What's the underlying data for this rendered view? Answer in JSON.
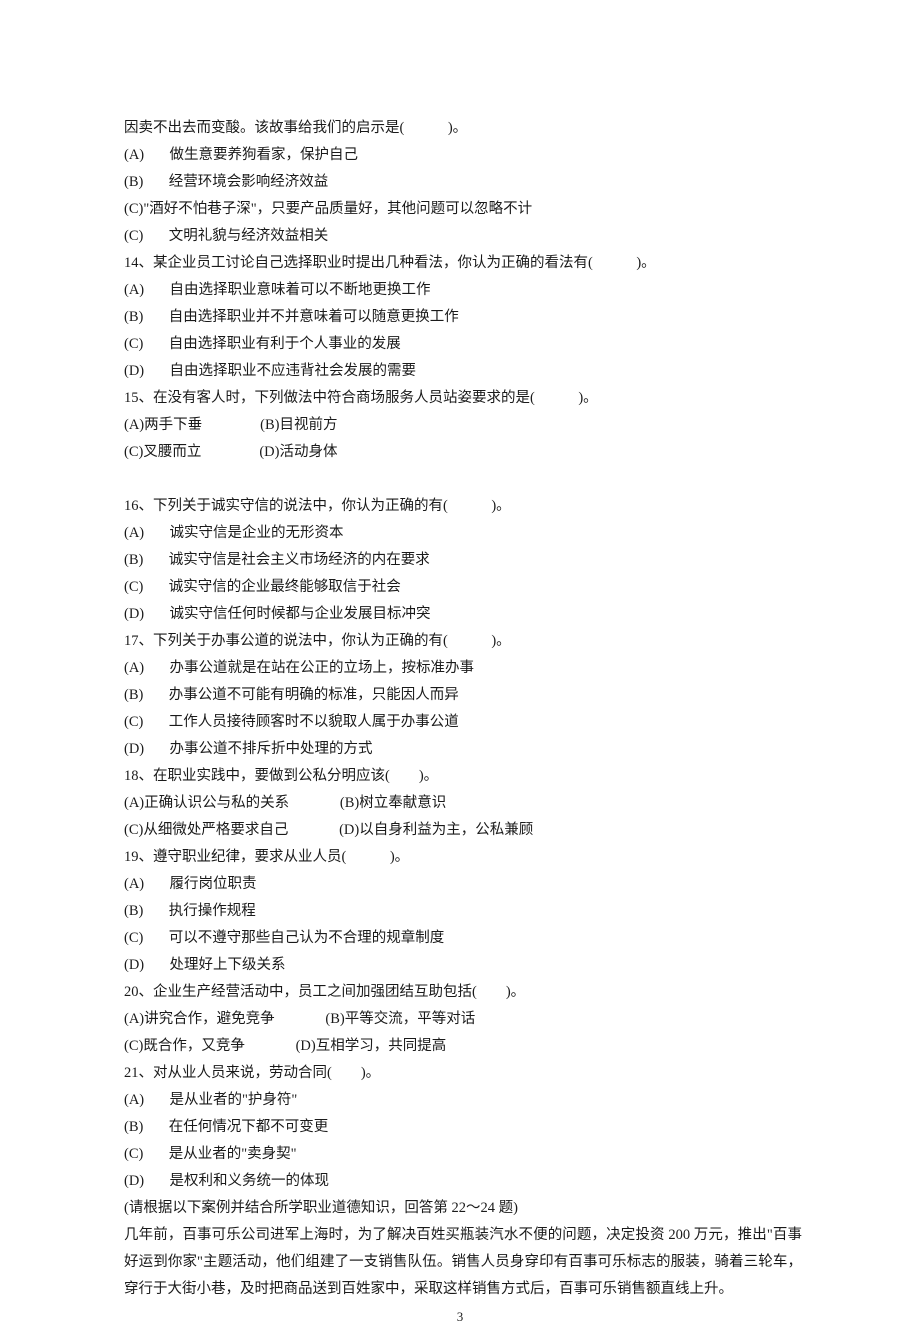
{
  "q13_intro": "因卖不出去而变酸。该故事给我们的启示是(            )。",
  "q13_A": "(A)       做生意要养狗看家，保护自己",
  "q13_B": "(B)       经营环境会影响经济效益",
  "q13_C": "(C)\"酒好不怕巷子深\"，只要产品质量好，其他问题可以忽略不计",
  "q13_D": "(C)       文明礼貌与经济效益相关",
  "q14_stem": "14、某企业员工讨论自己选择职业时提出几种看法，你认为正确的看法有(            )。",
  "q14_A": "(A)       自由选择职业意味着可以不断地更换工作",
  "q14_B": "(B)       自由选择职业并不并意味着可以随意更换工作",
  "q14_C": "(C)       自由选择职业有利于个人事业的发展",
  "q14_D": "(D)       自由选择职业不应违背社会发展的需要",
  "q15_stem": "15、在没有客人时，下列做法中符合商场服务人员站姿要求的是(            )。",
  "q15_row1": "(A)两手下垂                (B)目视前方",
  "q15_row2": "(C)叉腰而立                (D)活动身体",
  "q16_stem": "16、下列关于诚实守信的说法中，你认为正确的有(            )。",
  "q16_A": "(A)       诚实守信是企业的无形资本",
  "q16_B": "(B)       诚实守信是社会主义市场经济的内在要求",
  "q16_C": "(C)       诚实守信的企业最终能够取信于社会",
  "q16_D": "(D)       诚实守信任何时候都与企业发展目标冲突",
  "q17_stem": "17、下列关于办事公道的说法中，你认为正确的有(            )。",
  "q17_A": "(A)       办事公道就是在站在公正的立场上，按标准办事",
  "q17_B": "(B)       办事公道不可能有明确的标准，只能因人而异",
  "q17_C": "(C)       工作人员接待顾客时不以貌取人属于办事公道",
  "q17_D": "(D)       办事公道不排斥折中处理的方式",
  "q18_stem": "18、在职业实践中，要做到公私分明应该(        )。",
  "q18_row1": "(A)正确认识公与私的关系              (B)树立奉献意识",
  "q18_row2": "(C)从细微处严格要求自己              (D)以自身利益为主，公私兼顾",
  "q19_stem": "19、遵守职业纪律，要求从业人员(            )。",
  "q19_A": "(A)       履行岗位职责",
  "q19_B": "(B)       执行操作规程",
  "q19_C": "(C)       可以不遵守那些自己认为不合理的规章制度",
  "q19_D": "(D)       处理好上下级关系",
  "q20_stem": "20、企业生产经营活动中，员工之间加强团结互助包括(        )。",
  "q20_row1": "(A)讲究合作，避免竞争              (B)平等交流，平等对话",
  "q20_row2": "(C)既合作，又竞争              (D)互相学习，共同提高",
  "q21_stem": "21、对从业人员来说，劳动合同(        )。",
  "q21_A": "(A)       是从业者的\"护身符\"",
  "q21_B": "(B)       在任何情况下都不可变更",
  "q21_C": "(C)       是从业者的\"卖身契\"",
  "q21_D": "(D)       是权利和义务统一的体现",
  "case_note": "(请根据以下案例并结合所学职业道德知识，回答第 22～24 题)",
  "case_p1": "几年前，百事可乐公司进军上海时，为了解决百姓买瓶装汽水不便的问题，决定投资 200 万元，推出\"百事好运到你家\"主题活动，他们组建了一支销售队伍。销售人员身穿印有百事可乐标志的服装，骑着三轮车，穿行于大街小巷，及时把商品送到百姓家中，采取这样销售方式后，百事可乐销售额直线上升。",
  "page_number": "3"
}
